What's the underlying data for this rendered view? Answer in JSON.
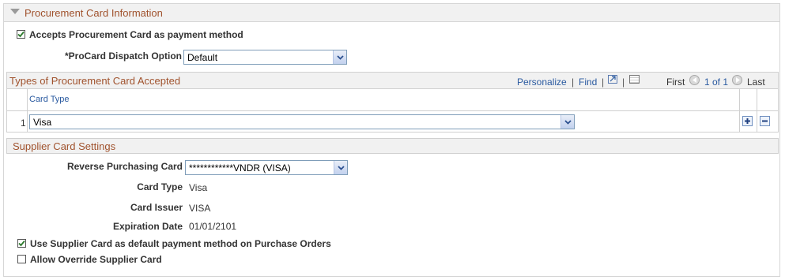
{
  "section": {
    "title": "Procurement Card Information"
  },
  "accepts_card": {
    "label": "Accepts Procurement Card as payment method",
    "checked": true
  },
  "dispatch": {
    "label": "*ProCard Dispatch Option",
    "value": "Default"
  },
  "grid": {
    "title": "Types of Procurement Card Accepted",
    "personalize": "Personalize",
    "find": "Find",
    "sep": "|",
    "first": "First",
    "range": "1 of 1",
    "last": "Last",
    "column": "Card Type",
    "rows": [
      {
        "num": "1",
        "card_type": "Visa"
      }
    ]
  },
  "supplier": {
    "title": "Supplier Card Settings",
    "reverse_label": "Reverse Purchasing Card",
    "reverse_value": "************VNDR (VISA)",
    "card_type_label": "Card Type",
    "card_type_value": "Visa",
    "issuer_label": "Card Issuer",
    "issuer_value": "VISA",
    "expiration_label": "Expiration Date",
    "expiration_value": "01/01/2101",
    "use_default": {
      "label": "Use Supplier Card as default payment method on Purchase Orders",
      "checked": true
    },
    "allow_override": {
      "label": "Allow Override Supplier Card",
      "checked": false
    }
  },
  "icons": {
    "section_toggle": "collapse-triangle-icon",
    "dropdown": "chevron-down-icon",
    "view_all": "view-all-icon",
    "download": "spreadsheet-icon",
    "prev": "previous-arrow-icon",
    "next": "next-arrow-icon",
    "add": "plus-icon",
    "delete": "minus-icon",
    "check": "checkmark-icon"
  }
}
